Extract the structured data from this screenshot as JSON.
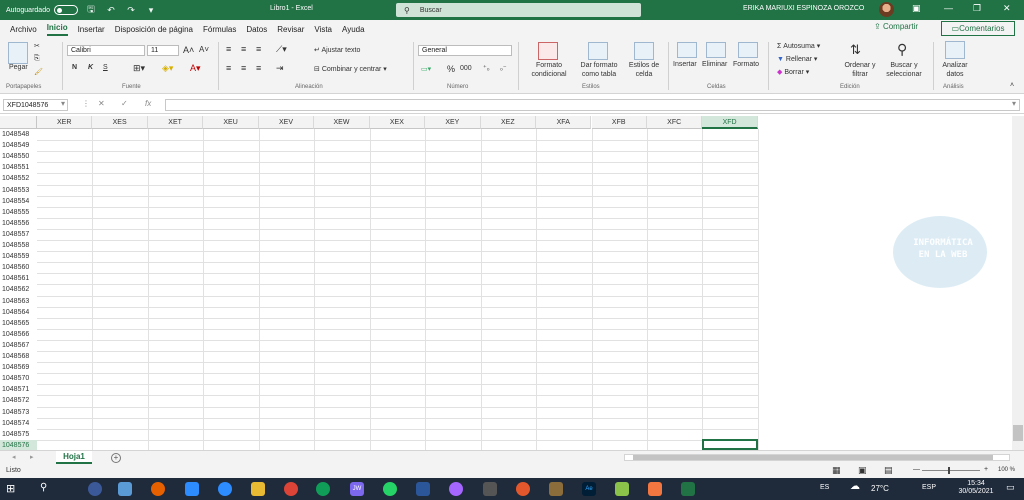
{
  "titlebar": {
    "autosave_label": "Autoguardado",
    "doc_title": "Libro1 - Excel",
    "search_placeholder": "Buscar",
    "user_name": "ERIKA MARIUXI ESPINOZA OROZCO",
    "bg_color": "#217346"
  },
  "menu": {
    "tabs": [
      "Archivo",
      "Inicio",
      "Insertar",
      "Disposición de página",
      "Fórmulas",
      "Datos",
      "Revisar",
      "Vista",
      "Ayuda"
    ],
    "active_tab": "Inicio",
    "share_label": "Compartir",
    "comments_label": "Comentarios"
  },
  "ribbon": {
    "clipboard": {
      "paste_label": "Pegar",
      "group_label": "Portapapeles"
    },
    "font": {
      "name": "Calibri",
      "size": "11",
      "bold": "N",
      "italic": "K",
      "underline": "S",
      "group_label": "Fuente"
    },
    "alignment": {
      "wrap_label": "Ajustar texto",
      "merge_label": "Combinar y centrar",
      "group_label": "Alineación"
    },
    "number": {
      "format": "General",
      "percent": "%",
      "thousands": "000",
      "group_label": "Número"
    },
    "styles": {
      "cond_label": [
        "Formato",
        "condicional"
      ],
      "table_label": [
        "Dar formato",
        "como tabla"
      ],
      "cell_styles_label": [
        "Estilos de",
        "celda"
      ],
      "group_label": "Estilos"
    },
    "cells": {
      "insert_label": "Insertar",
      "delete_label": "Eliminar",
      "format_label": "Formato",
      "group_label": "Celdas"
    },
    "editing": {
      "autosum_label": "Autosuma",
      "fill_label": "Rellenar",
      "clear_label": "Borrar",
      "sort_label": [
        "Ordenar y",
        "filtrar"
      ],
      "find_label": [
        "Buscar y",
        "seleccionar"
      ],
      "group_label": "Edición"
    },
    "analysis": {
      "analyze_label": [
        "Analizar",
        "datos"
      ],
      "group_label": "Análisis"
    }
  },
  "formula_bar": {
    "name_box": "XFD1048576",
    "cancel": "✕",
    "enter": "✓",
    "fx": "fx",
    "value": ""
  },
  "grid": {
    "columns": [
      "XER",
      "XES",
      "XET",
      "XEU",
      "XEV",
      "XEW",
      "XEX",
      "XEY",
      "XEZ",
      "XFA",
      "XFB",
      "XFC",
      "XFD"
    ],
    "selected_column": "XFD",
    "rows": [
      "1048548",
      "1048549",
      "1048550",
      "1048551",
      "1048552",
      "1048553",
      "1048554",
      "1048555",
      "1048556",
      "1048557",
      "1048558",
      "1048559",
      "1048560",
      "1048561",
      "1048562",
      "1048563",
      "1048564",
      "1048565",
      "1048566",
      "1048567",
      "1048568",
      "1048569",
      "1048570",
      "1048571",
      "1048572",
      "1048573",
      "1048574",
      "1048575",
      "1048576"
    ],
    "selected_row": "1048576"
  },
  "watermark": {
    "line1": "INFORMÁTICA",
    "line2": "EN LA WEB"
  },
  "sheet_tabs": {
    "active": "Hoja1"
  },
  "status": {
    "ready": "Listo",
    "zoom": "100 %"
  },
  "taskbar": {
    "lang1": "ES",
    "temp": "27°C",
    "lang2": "ESP",
    "time": "15:34",
    "date": "30/05/2021"
  }
}
